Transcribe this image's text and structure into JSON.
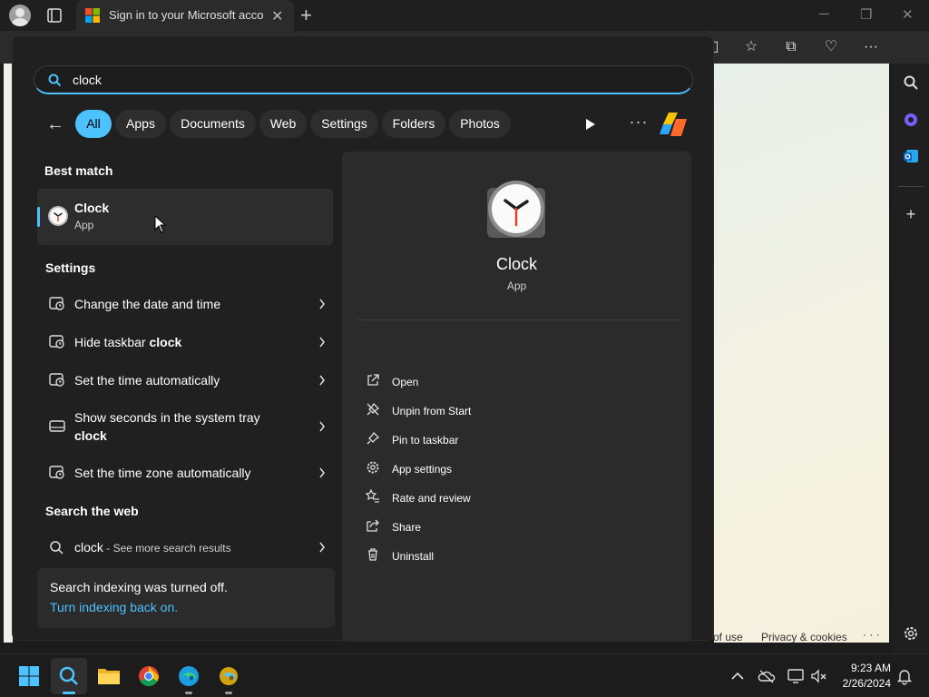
{
  "browser": {
    "tab_title": "Sign in to your Microsoft account",
    "tab_close": "✕",
    "new_tab": "+",
    "footer": {
      "terms": "of use",
      "privacy": "Privacy & cookies",
      "more": "· · ·"
    }
  },
  "search": {
    "query": "clock",
    "filters": [
      {
        "label": "All",
        "active": true
      },
      {
        "label": "Apps",
        "active": false
      },
      {
        "label": "Documents",
        "active": false
      },
      {
        "label": "Web",
        "active": false
      },
      {
        "label": "Settings",
        "active": false
      },
      {
        "label": "Folders",
        "active": false
      },
      {
        "label": "Photos",
        "active": false
      }
    ],
    "more": "···",
    "best_match_heading": "Best match",
    "best_match": {
      "name": "Clock",
      "type": "App"
    },
    "settings_heading": "Settings",
    "settings": [
      {
        "pre": "Change the date and time",
        "bold": "",
        "icon": "clock-settings-icon"
      },
      {
        "pre": "Hide taskbar ",
        "bold": "clock",
        "icon": "clock-settings-icon"
      },
      {
        "pre": "Set the time automatically",
        "bold": "",
        "icon": "clock-settings-icon"
      },
      {
        "pre": "Show seconds in the system tray",
        "bold": "clock",
        "icon": "taskbar-icon"
      },
      {
        "pre": "Set the time zone automatically",
        "bold": "",
        "icon": "clock-settings-icon"
      }
    ],
    "web_heading": "Search the web",
    "web": {
      "term": "clock",
      "suffix": " - See more search results"
    },
    "indexing": {
      "message": "Search indexing was turned off.",
      "link": "Turn indexing back on."
    }
  },
  "detail": {
    "name": "Clock",
    "type": "App",
    "actions": [
      {
        "label": "Open",
        "icon": "open-external-icon"
      },
      {
        "label": "Unpin from Start",
        "icon": "unpin-icon"
      },
      {
        "label": "Pin to taskbar",
        "icon": "pin-icon"
      },
      {
        "label": "App settings",
        "icon": "gear-icon"
      },
      {
        "label": "Rate and review",
        "icon": "star-review-icon"
      },
      {
        "label": "Share",
        "icon": "share-icon"
      },
      {
        "label": "Uninstall",
        "icon": "trash-icon"
      }
    ]
  },
  "taskbar": {
    "time": "9:23 AM",
    "date": "2/26/2024"
  },
  "colors": {
    "accent": "#4cc2ff",
    "panel": "#202020",
    "card": "#2b2b2b"
  }
}
